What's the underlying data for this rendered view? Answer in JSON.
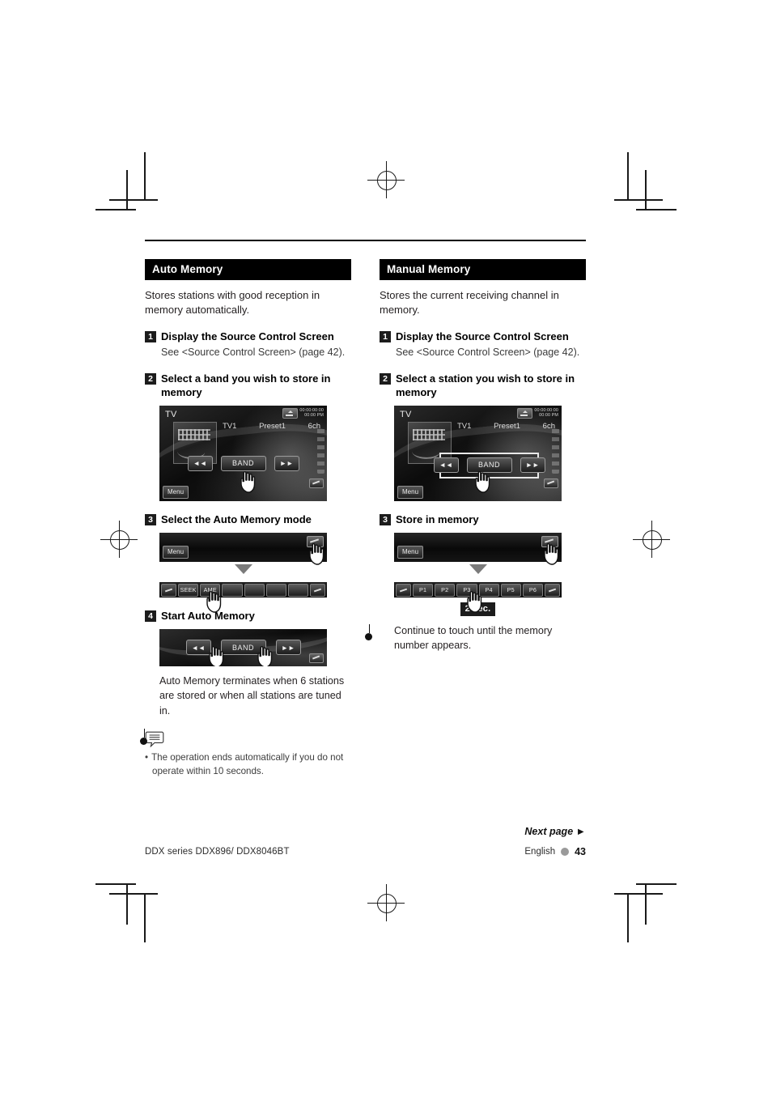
{
  "footer": {
    "next_page": "Next page ►",
    "model": "DDX series  DDX896/ DDX8046BT",
    "language": "English",
    "page_number": "43"
  },
  "left_column": {
    "heading": "Auto Memory",
    "intro": "Stores stations with good reception in memory automatically.",
    "steps": [
      {
        "num": "1",
        "title": "Display the Source Control Screen",
        "sub": "See <Source Control Screen> (page 42)."
      },
      {
        "num": "2",
        "title": "Select a band you wish to store in memory"
      },
      {
        "num": "3",
        "title": "Select the Auto Memory mode"
      },
      {
        "num": "4",
        "title": "Start Auto Memory"
      }
    ],
    "after_step4_text": "Auto Memory terminates when 6 stations are stored or when all stations are tuned in.",
    "note_bullet": "•",
    "note_text": "The operation ends automatically if you do not operate within 10 seconds.",
    "screen_tv": {
      "source_label": "TV",
      "band": "TV1",
      "preset": "Preset1",
      "channel": "6ch",
      "clock_line1": "00:00:00:00",
      "clock_line2": "00:00 PM",
      "key_prev": "◄◄",
      "key_band": "BAND",
      "key_next": "►►",
      "key_menu": "Menu"
    },
    "screen_bar": {
      "key_menu": "Menu"
    },
    "screen_strip": {
      "keys": [
        "",
        "SEEK",
        "AME",
        "",
        "",
        "",
        "",
        ""
      ]
    },
    "screen_band4": {
      "key_prev": "◄◄",
      "key_band": "BAND",
      "key_next": "►►"
    }
  },
  "right_column": {
    "heading": "Manual Memory",
    "intro": "Stores the current receiving channel in memory.",
    "steps": [
      {
        "num": "1",
        "title": "Display the Source Control Screen",
        "sub": "See <Source Control Screen> (page 42)."
      },
      {
        "num": "2",
        "title": "Select a station you wish to store in memory"
      },
      {
        "num": "3",
        "title": "Store in memory"
      }
    ],
    "hold_badge": "2 sec.",
    "after_text": "Continue to touch until the memory number appears.",
    "screen_tv": {
      "source_label": "TV",
      "band": "TV1",
      "preset": "Preset1",
      "channel": "6ch",
      "clock_line1": "00:00:00:00",
      "clock_line2": "00:00 PM",
      "key_prev": "◄◄",
      "key_band": "BAND",
      "key_next": "►►",
      "key_menu": "Menu"
    },
    "screen_bar": {
      "key_menu": "Menu"
    },
    "screen_presets": {
      "keys": [
        "",
        "P1",
        "P2",
        "P3",
        "P4",
        "P5",
        "P6",
        ""
      ]
    }
  }
}
